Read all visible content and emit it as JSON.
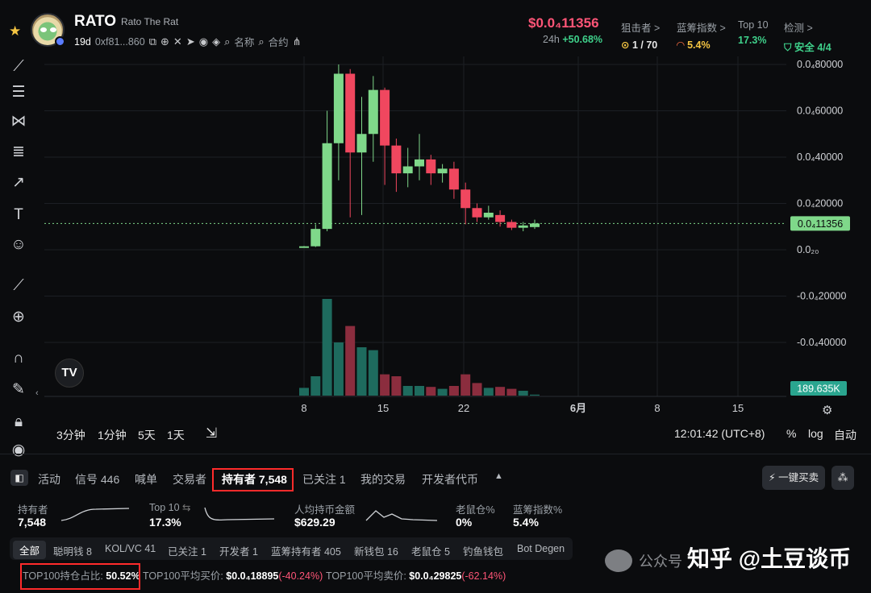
{
  "header": {
    "token_symbol": "RATO",
    "token_name": "Rato The Rat",
    "age": "19d",
    "address": "0xf81...860",
    "search_name": "名称",
    "search_contract": "合约",
    "price": "$0.0₄11356",
    "price_period": "24h",
    "price_change": "+50.68%",
    "stats": [
      {
        "label": "狙击者 >",
        "value": "1 / 70",
        "color": "#e6e6e6"
      },
      {
        "label": "蓝筹指数 >",
        "value": "5.4%",
        "color": "#f5c542"
      },
      {
        "label": "Top 10",
        "value": "17.3%",
        "color": "#3fd18b"
      },
      {
        "label": "检测 >",
        "value": "安全 4/4",
        "color": "#3fd18b"
      }
    ]
  },
  "chart": {
    "price_axis": [
      "0.0₄80000",
      "0.0₄60000",
      "0.0₄40000",
      "0.0₄20000",
      "0.0₂₀",
      "-0.0₄20000",
      "-0.0₄40000"
    ],
    "current_price_tag": "0.0₄11356",
    "volume_tag": "189.635K",
    "date_axis": [
      "8",
      "15",
      "22",
      "6月",
      "8",
      "15"
    ],
    "timeframes": [
      "3分钟",
      "1分钟",
      "5天",
      "1天"
    ],
    "clock": "12:01:42 (UTC+8)",
    "scale_opts": [
      "%",
      "log",
      "自动"
    ]
  },
  "chart_data": {
    "type": "candlestick",
    "x": [
      "8",
      "15",
      "22",
      "6月",
      "8",
      "15"
    ],
    "candles": [
      {
        "o": 1000,
        "c": 1500,
        "h": 1600,
        "l": 900
      },
      {
        "o": 1500,
        "c": 9000,
        "h": 11000,
        "l": 1200
      },
      {
        "o": 9000,
        "c": 46000,
        "h": 60000,
        "l": 8000
      },
      {
        "o": 46000,
        "c": 76000,
        "h": 80000,
        "l": 30000
      },
      {
        "o": 76000,
        "c": 42000,
        "h": 78000,
        "l": 14000
      },
      {
        "o": 42000,
        "c": 50000,
        "h": 66000,
        "l": 15000
      },
      {
        "o": 50000,
        "c": 69000,
        "h": 75000,
        "l": 38000
      },
      {
        "o": 69000,
        "c": 45000,
        "h": 70000,
        "l": 28000
      },
      {
        "o": 45000,
        "c": 33000,
        "h": 48000,
        "l": 25000
      },
      {
        "o": 33000,
        "c": 36000,
        "h": 44000,
        "l": 27000
      },
      {
        "o": 36000,
        "c": 39000,
        "h": 50000,
        "l": 30000
      },
      {
        "o": 39000,
        "c": 33000,
        "h": 41000,
        "l": 28000
      },
      {
        "o": 33000,
        "c": 35000,
        "h": 37000,
        "l": 29000
      },
      {
        "o": 35000,
        "c": 26000,
        "h": 38000,
        "l": 22000
      },
      {
        "o": 26000,
        "c": 18000,
        "h": 29000,
        "l": 11000
      },
      {
        "o": 18000,
        "c": 14000,
        "h": 20000,
        "l": 12000
      },
      {
        "o": 14000,
        "c": 16000,
        "h": 19000,
        "l": 13000
      },
      {
        "o": 15000,
        "c": 12000,
        "h": 17000,
        "l": 10000
      },
      {
        "o": 12000,
        "c": 9500,
        "h": 13000,
        "l": 8500
      },
      {
        "o": 9500,
        "c": 10500,
        "h": 12000,
        "l": 8000
      },
      {
        "o": 9800,
        "c": 11356,
        "h": 13000,
        "l": 9000
      }
    ],
    "volumes": [
      8,
      20,
      100,
      55,
      72,
      50,
      47,
      22,
      20,
      10,
      10,
      9,
      7,
      10,
      22,
      13,
      8,
      9,
      7,
      5,
      1
    ],
    "ylim": [
      -40000,
      80000
    ]
  },
  "tabs": [
    {
      "label": "活动"
    },
    {
      "label": "信号 446"
    },
    {
      "label": "喊单"
    },
    {
      "label": "交易者"
    },
    {
      "label": "持有者 7,548"
    },
    {
      "label": "已关注 1"
    },
    {
      "label": "我的交易"
    },
    {
      "label": "开发者代币"
    }
  ],
  "quick_buy": "一键买卖",
  "summary": [
    {
      "label": "持有者",
      "value": "7,548"
    },
    {
      "label": "Top 10",
      "value": "17.3%"
    },
    {
      "label": "人均持币金额",
      "value": "$629.29"
    },
    {
      "label": "老鼠仓%",
      "value": "0%"
    },
    {
      "label": "蓝筹指数%",
      "value": "5.4%"
    }
  ],
  "filters": [
    "全部",
    "聪明钱 8",
    "KOL/VC 41",
    "已关注 1",
    "开发者 1",
    "蓝筹持有者 405",
    "新钱包 16",
    "老鼠仓 5",
    "钓鱼钱包",
    "Bot Degen"
  ],
  "bottom": {
    "top100_ratio_label": "TOP100持仓占比:",
    "top100_ratio": "50.52%",
    "avg_buy_label": "TOP100平均买价:",
    "avg_buy": "$0.0₄18895",
    "avg_buy_change": "(-40.24%)",
    "avg_sell_label": "TOP100平均卖价:",
    "avg_sell": "$0.0₄29825",
    "avg_sell_change": "(-62.14%)"
  },
  "watermark": {
    "text": "知乎 @土豆谈币",
    "small": "公众号"
  }
}
